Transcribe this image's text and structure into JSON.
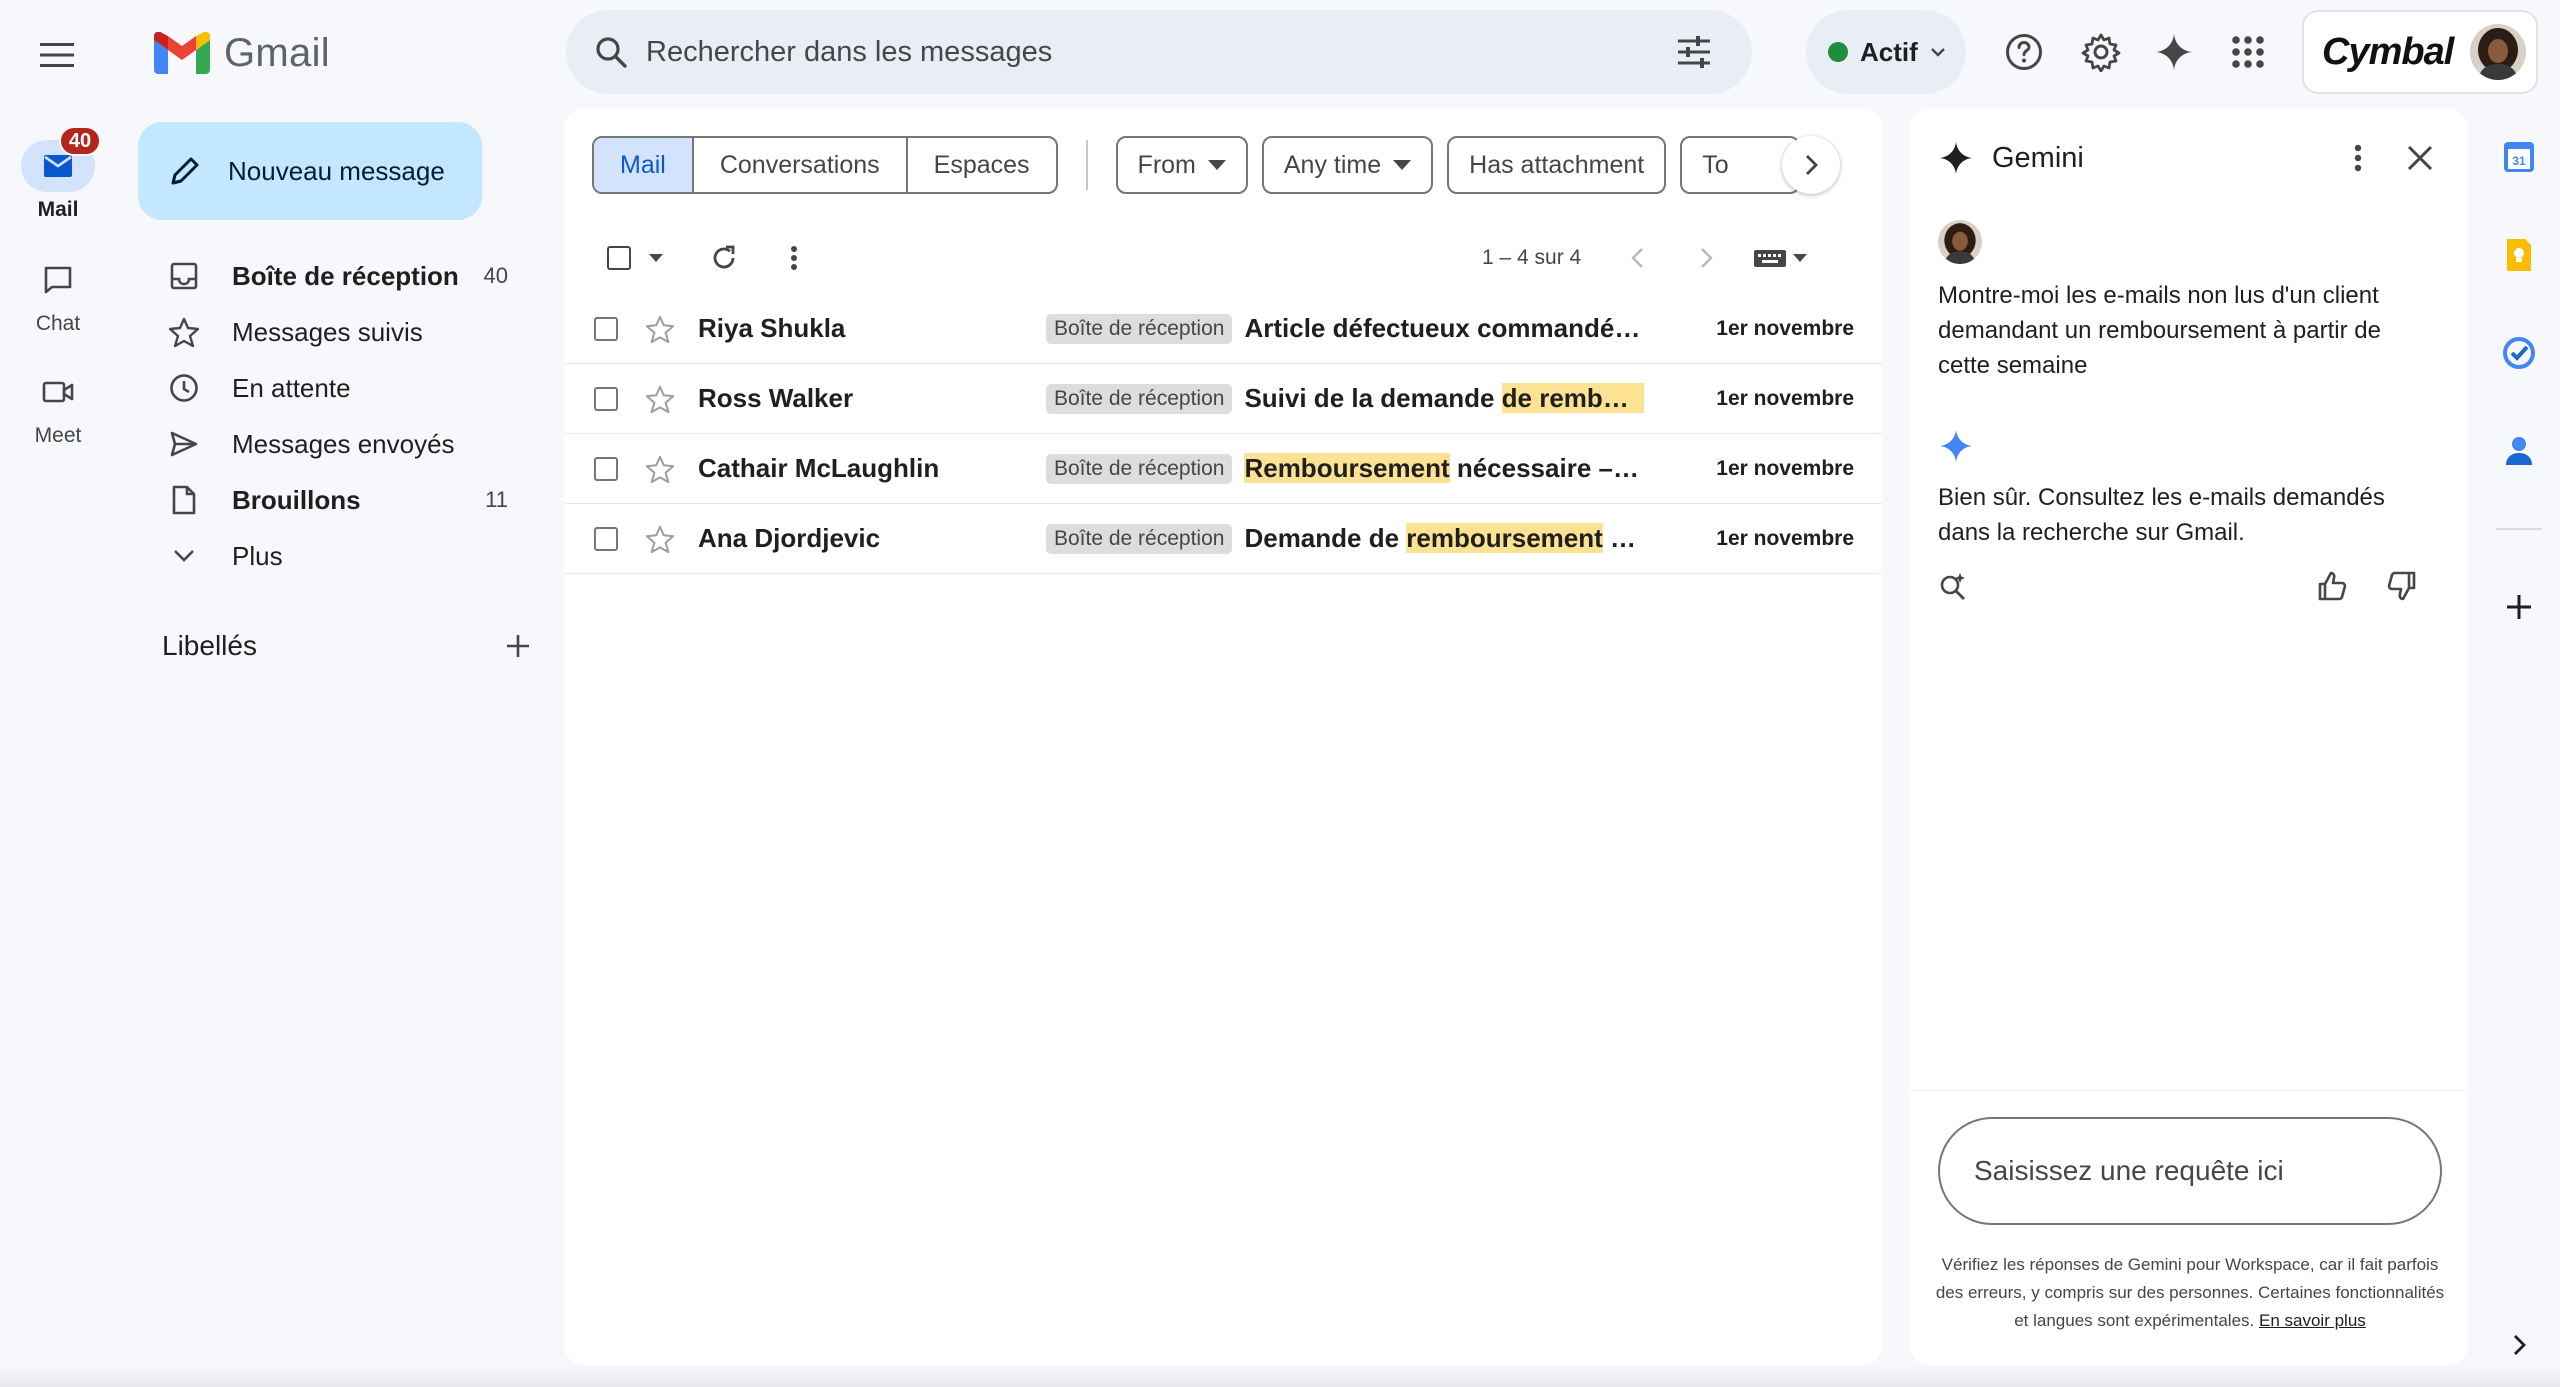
{
  "app": {
    "name": "Gmail",
    "hamburger_icon": "menu-icon"
  },
  "search": {
    "placeholder": "Rechercher dans les messages"
  },
  "status": {
    "label": "Actif",
    "color": "#1e8e3e"
  },
  "account": {
    "brand": "Cymbal"
  },
  "rail": {
    "items": [
      {
        "label": "Mail",
        "badge": "40",
        "icon": "mail-icon",
        "active": true
      },
      {
        "label": "Chat",
        "icon": "chat-icon"
      },
      {
        "label": "Meet",
        "icon": "video-icon"
      }
    ]
  },
  "compose": {
    "label": "Nouveau message"
  },
  "nav": {
    "items": [
      {
        "label": "Boîte de réception",
        "count": "40",
        "icon": "inbox-icon",
        "bold": true
      },
      {
        "label": "Messages suivis",
        "icon": "star-icon"
      },
      {
        "label": "En attente",
        "icon": "clock-icon"
      },
      {
        "label": "Messages envoyés",
        "icon": "send-icon"
      },
      {
        "label": "Brouillons",
        "count": "11",
        "icon": "draft-icon",
        "bold": true
      },
      {
        "label": "Plus",
        "icon": "chevron-down-icon"
      }
    ]
  },
  "labels": {
    "title": "Libellés"
  },
  "tabs": {
    "mail": "Mail",
    "conversations": "Conversations",
    "spaces": "Espaces"
  },
  "chips": {
    "from": "From",
    "any_time": "Any time",
    "has_attachment": "Has attachment",
    "to": "To"
  },
  "pagination": {
    "range": "1 – 4 sur 4"
  },
  "emails": [
    {
      "sender": "Riya Shukla",
      "label": "Boîte de réception",
      "subject_pre": "Article défectueux commandé #...",
      "subject_hl": "",
      "subject_post": "",
      "date": "1er novembre"
    },
    {
      "sender": "Ross Walker",
      "label": "Boîte de réception",
      "subject_pre": "Suivi de la demande ",
      "subject_hl": "de rembour...",
      "subject_post": "",
      "date": "1er novembre"
    },
    {
      "sender": "Cathair McLaughlin",
      "label": "Boîte de réception",
      "subject_pre": "",
      "subject_hl": "Remboursement",
      "subject_post": " nécessaire – C...",
      "date": "1er novembre"
    },
    {
      "sender": "Ana Djordjevic",
      "label": "Boîte de réception",
      "subject_pre": "Demande de ",
      "subject_hl": "remboursement",
      "subject_post": " su...",
      "date": "1er novembre"
    }
  ],
  "gemini": {
    "title": "Gemini",
    "prompt": "Montre-moi les e-mails non lus d'un client demandant un remboursement à partir de cette semaine",
    "answer": "Bien sûr. Consultez les e-mails demandés dans la recherche sur Gmail.",
    "input_placeholder": "Saisissez une requête ici",
    "disclaimer": "Vérifiez les réponses de Gemini pour Workspace, car il fait parfois des erreurs, y compris sur des personnes. Certaines fonctionnalités et langues sont expérimentales.",
    "learn_more": "En savoir plus"
  },
  "colors": {
    "background": "#f6f8fc",
    "compose": "#c2e7ff",
    "active_tab": "#d3e3fd",
    "highlight": "#fde293",
    "badge": "#b3261e",
    "gemini_accent": "#4285f4"
  }
}
